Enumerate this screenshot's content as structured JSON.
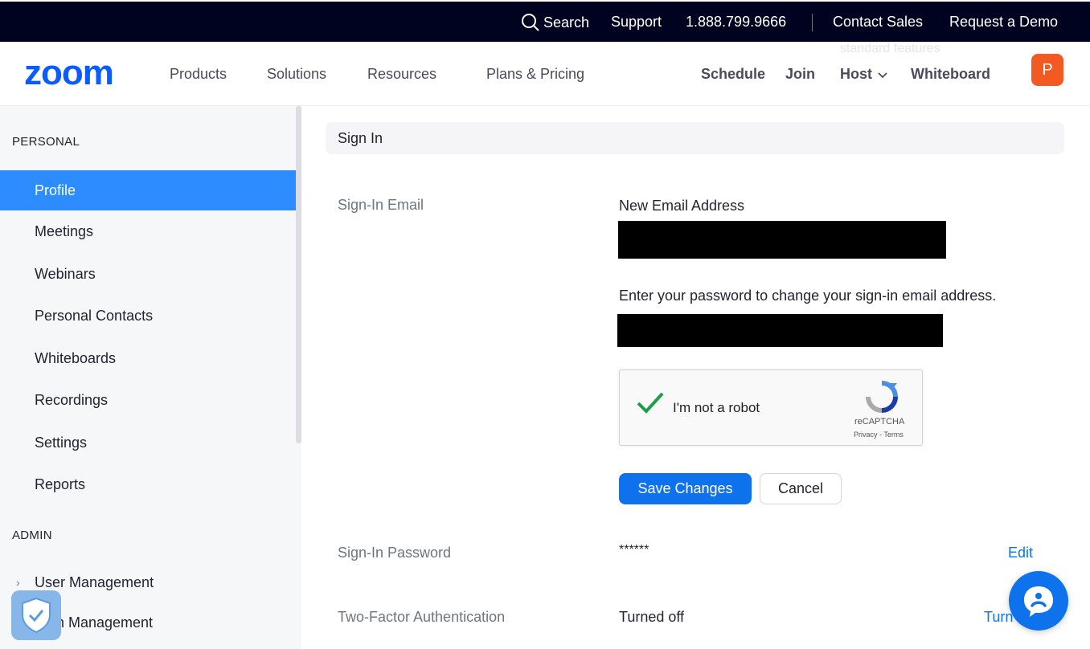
{
  "topbar": {
    "search_label": "Search",
    "support": "Support",
    "phone": "1.888.799.9666",
    "contact_sales": "Contact Sales",
    "request_demo": "Request a Demo"
  },
  "nav": {
    "logo_text": "zoom",
    "products": "Products",
    "solutions": "Solutions",
    "resources": "Resources",
    "plans": "Plans & Pricing",
    "schedule": "Schedule",
    "join": "Join",
    "host": "Host",
    "whiteboard": "Whiteboard",
    "ghost_text": "standard features",
    "avatar_initial": "P"
  },
  "sidebar": {
    "personal_heading": "PERSONAL",
    "items": [
      {
        "label": "Profile"
      },
      {
        "label": "Meetings"
      },
      {
        "label": "Webinars"
      },
      {
        "label": "Personal Contacts"
      },
      {
        "label": "Whiteboards"
      },
      {
        "label": "Recordings"
      },
      {
        "label": "Settings"
      },
      {
        "label": "Reports"
      }
    ],
    "admin_heading": "ADMIN",
    "admin_items": [
      {
        "label": "User Management"
      },
      {
        "label": "m Management"
      }
    ]
  },
  "main": {
    "section_title": "Sign In",
    "signin_email_label": "Sign-In Email",
    "new_email_label": "New Email Address",
    "password_prompt": "Enter your password to change your sign-in email address.",
    "captcha": {
      "text": "I'm not a robot",
      "brand": "reCAPTCHA",
      "terms": "Privacy - Terms"
    },
    "save_button": "Save Changes",
    "cancel_button": "Cancel",
    "signin_password_label": "Sign-In Password",
    "password_mask": "******",
    "edit_link": "Edit",
    "tfa_label": "Two-Factor Authentication",
    "tfa_status": "Turned off",
    "tfa_link": "Turn"
  },
  "colors": {
    "topbar_bg": "#00031f",
    "brand_blue": "#0e72ed",
    "active_blue": "#2d8cff",
    "avatar_orange": "#f35a22"
  }
}
